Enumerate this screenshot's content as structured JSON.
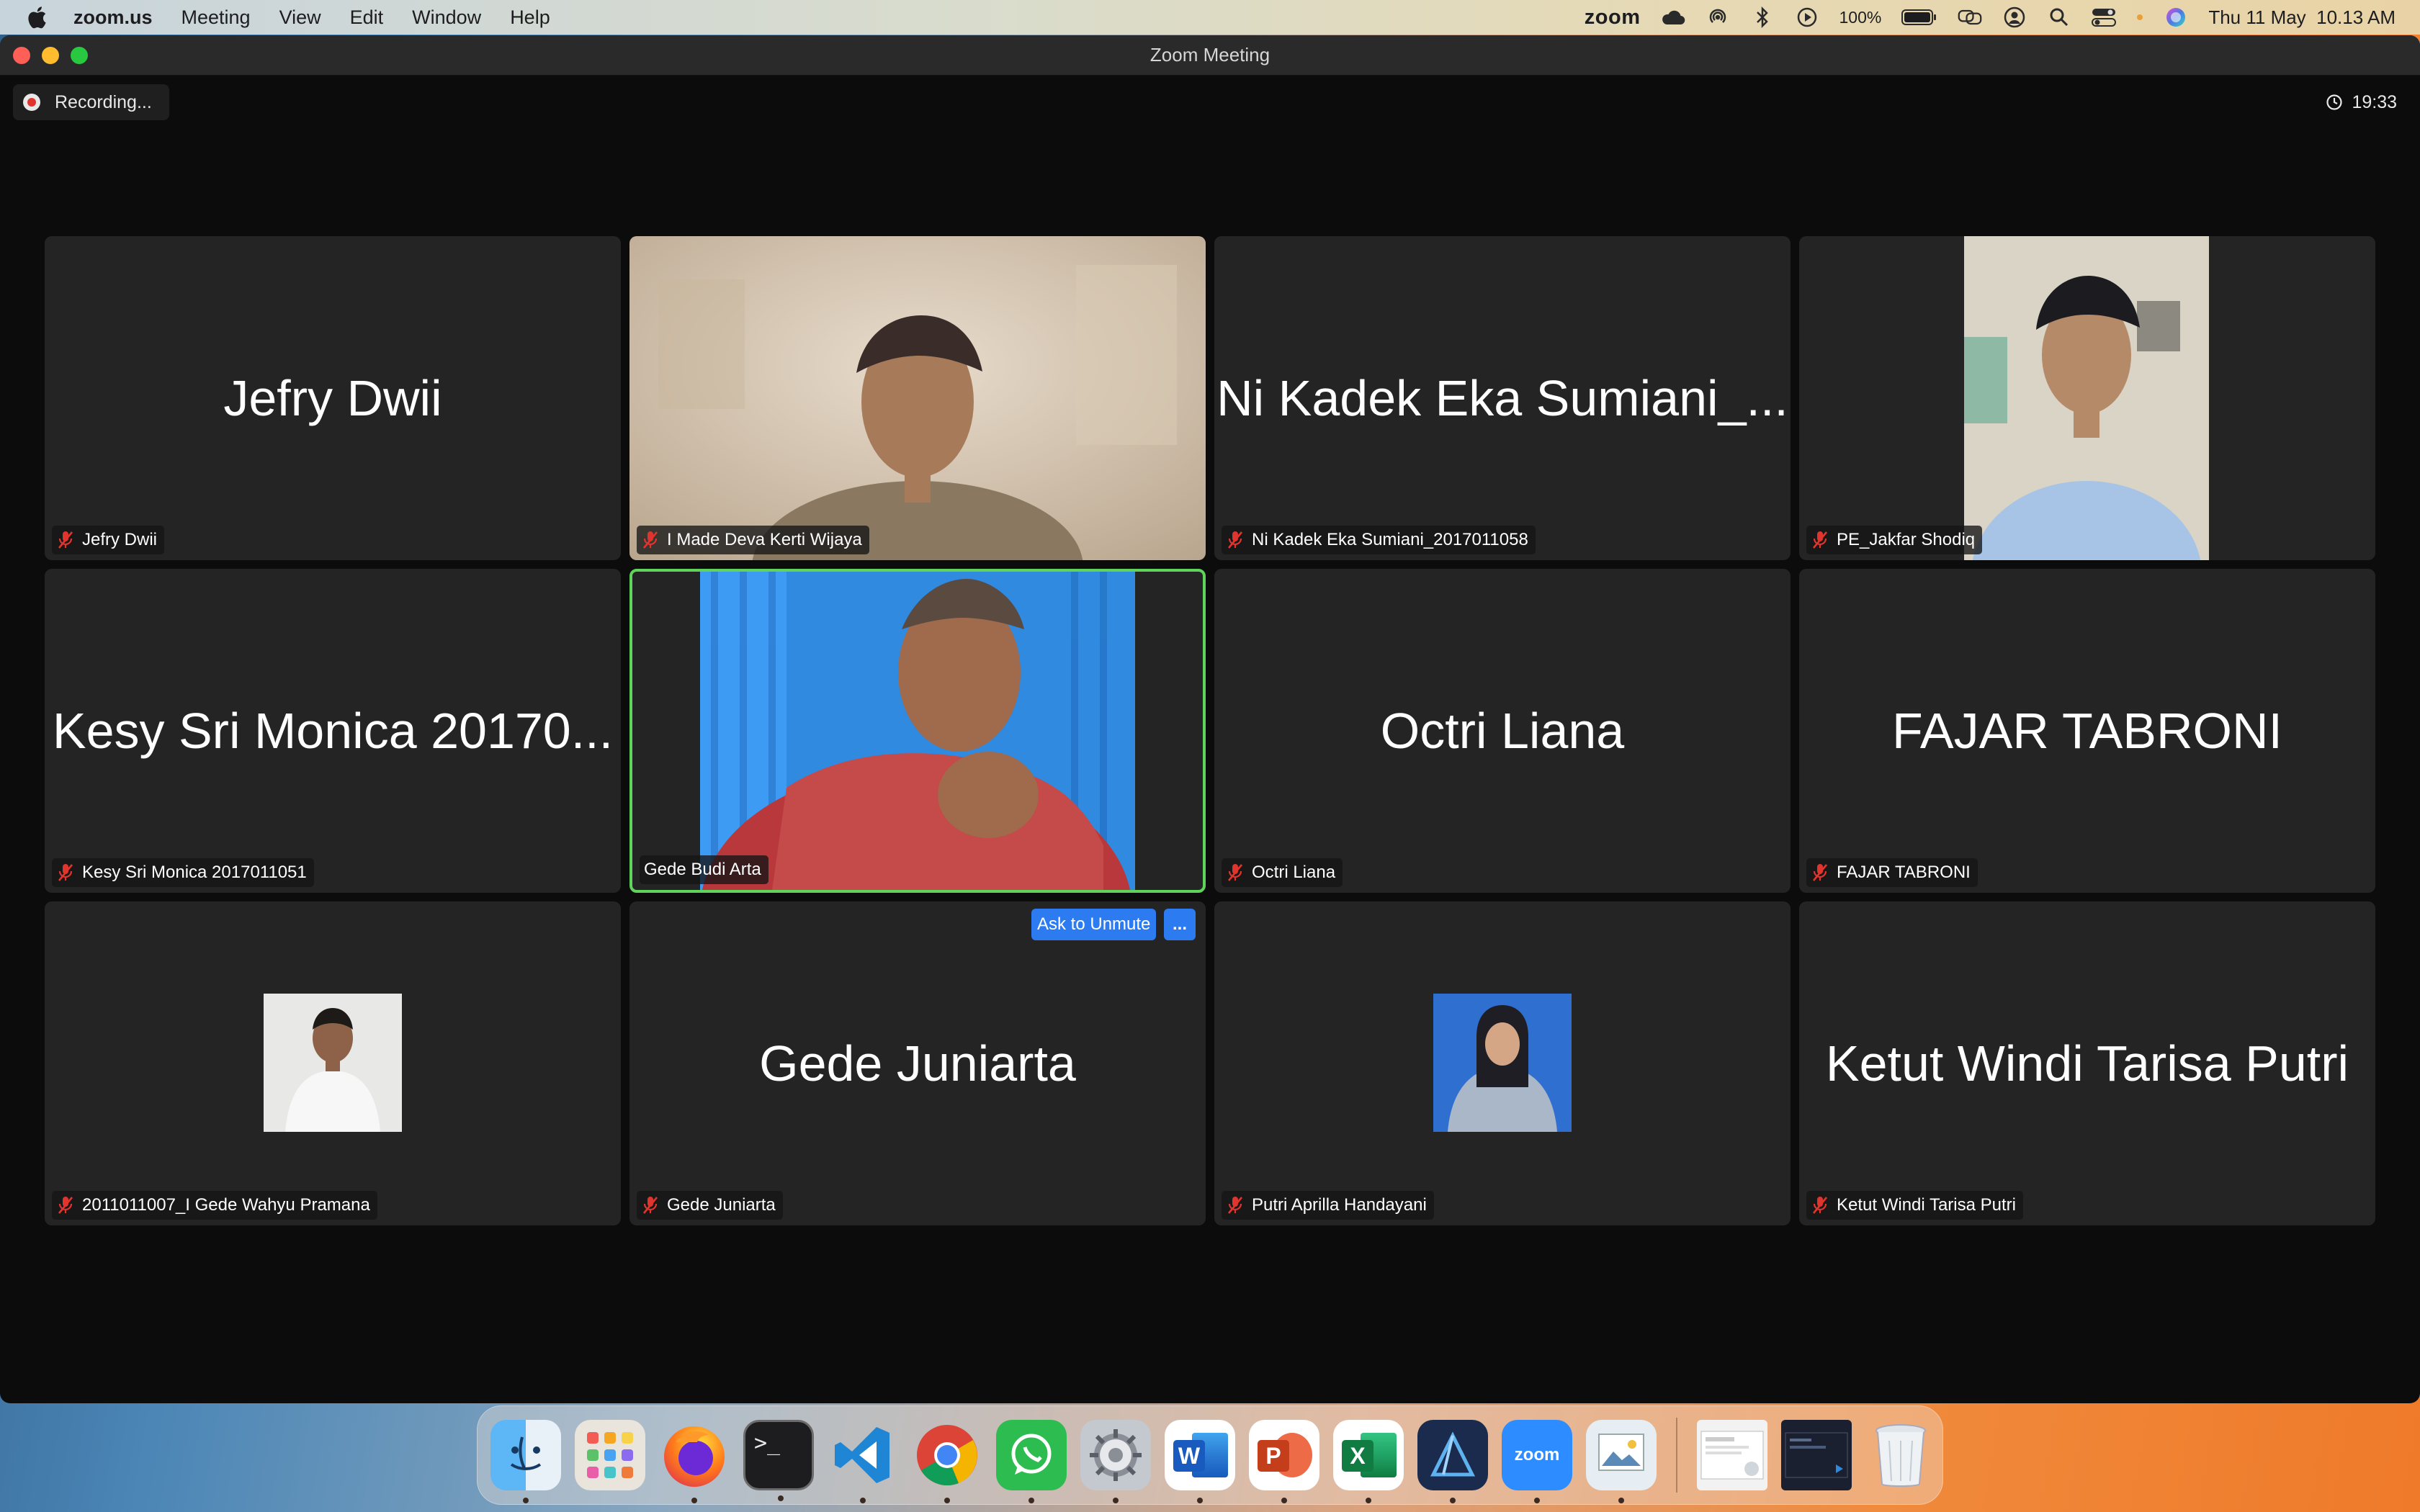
{
  "menubar": {
    "app_name": "zoom.us",
    "menus": [
      "Meeting",
      "View",
      "Edit",
      "Window",
      "Help"
    ],
    "zoom_label": "zoom",
    "battery": "100%",
    "clock": "Thu 11 May  10.13 AM",
    "icons": [
      "apple-icon",
      "creative-cloud-icon",
      "airdrop-icon",
      "bluetooth-icon",
      "play-icon",
      "battery-icon",
      "screen-mirror-icon",
      "user-icon",
      "search-icon",
      "control-center-icon",
      "siri-icon"
    ]
  },
  "window": {
    "title": "Zoom Meeting",
    "recording": "Recording...",
    "timer": "19:33"
  },
  "participants": [
    {
      "display": "Jefry Dwii",
      "label": "Jefry Dwii",
      "muted": true,
      "video": false
    },
    {
      "display": "",
      "label": "I Made Deva Kerti Wijaya",
      "muted": true,
      "video": true
    },
    {
      "display": "Ni Kadek Eka Sumiani_...",
      "label": "Ni Kadek Eka Sumiani_2017011058",
      "muted": true,
      "video": false
    },
    {
      "display": "",
      "label": "PE_Jakfar Shodiq",
      "muted": true,
      "video": true
    },
    {
      "display": "Kesy Sri Monica 20170...",
      "label": "Kesy Sri Monica 2017011051",
      "muted": true,
      "video": false
    },
    {
      "display": "",
      "label": "Gede Budi Arta",
      "muted": false,
      "video": true,
      "active_speaker": true
    },
    {
      "display": "Octri Liana",
      "label": "Octri Liana",
      "muted": true,
      "video": false
    },
    {
      "display": "FAJAR TABRONI",
      "label": "FAJAR TABRONI",
      "muted": true,
      "video": false
    },
    {
      "display": "",
      "label": "2011011007_I Gede Wahyu Pramana",
      "muted": true,
      "video": false,
      "photo": true
    },
    {
      "display": "Gede Juniarta",
      "label": "Gede Juniarta",
      "muted": true,
      "video": false
    },
    {
      "display": "",
      "label": "Putri Aprilla Handayani",
      "muted": true,
      "video": false,
      "photo": true
    },
    {
      "display": "Ketut Windi Tarisa Putri",
      "label": "Ketut Windi Tarisa Putri",
      "muted": true,
      "video": false
    }
  ],
  "hover_actions": {
    "ask_to_unmute": "Ask to Unmute",
    "more": "..."
  },
  "colors": {
    "active_border": "#5fd35a",
    "button_blue": "#2d7bf0",
    "tile_bg": "#242424",
    "mute_red": "#e0352f"
  },
  "dock": {
    "apps": [
      "Finder",
      "Launchpad",
      "Firefox",
      "Terminal",
      "Visual Studio Code",
      "Google Chrome",
      "WhatsApp",
      "System Preferences",
      "Microsoft Word",
      "Microsoft PowerPoint",
      "Microsoft Excel",
      "Affinity Designer",
      "zoom.us",
      "Preview"
    ],
    "zoom_label": "zoom",
    "terminal_label": ">_",
    "word_label": "W",
    "ppt_label": "P",
    "excel_label": "X"
  }
}
